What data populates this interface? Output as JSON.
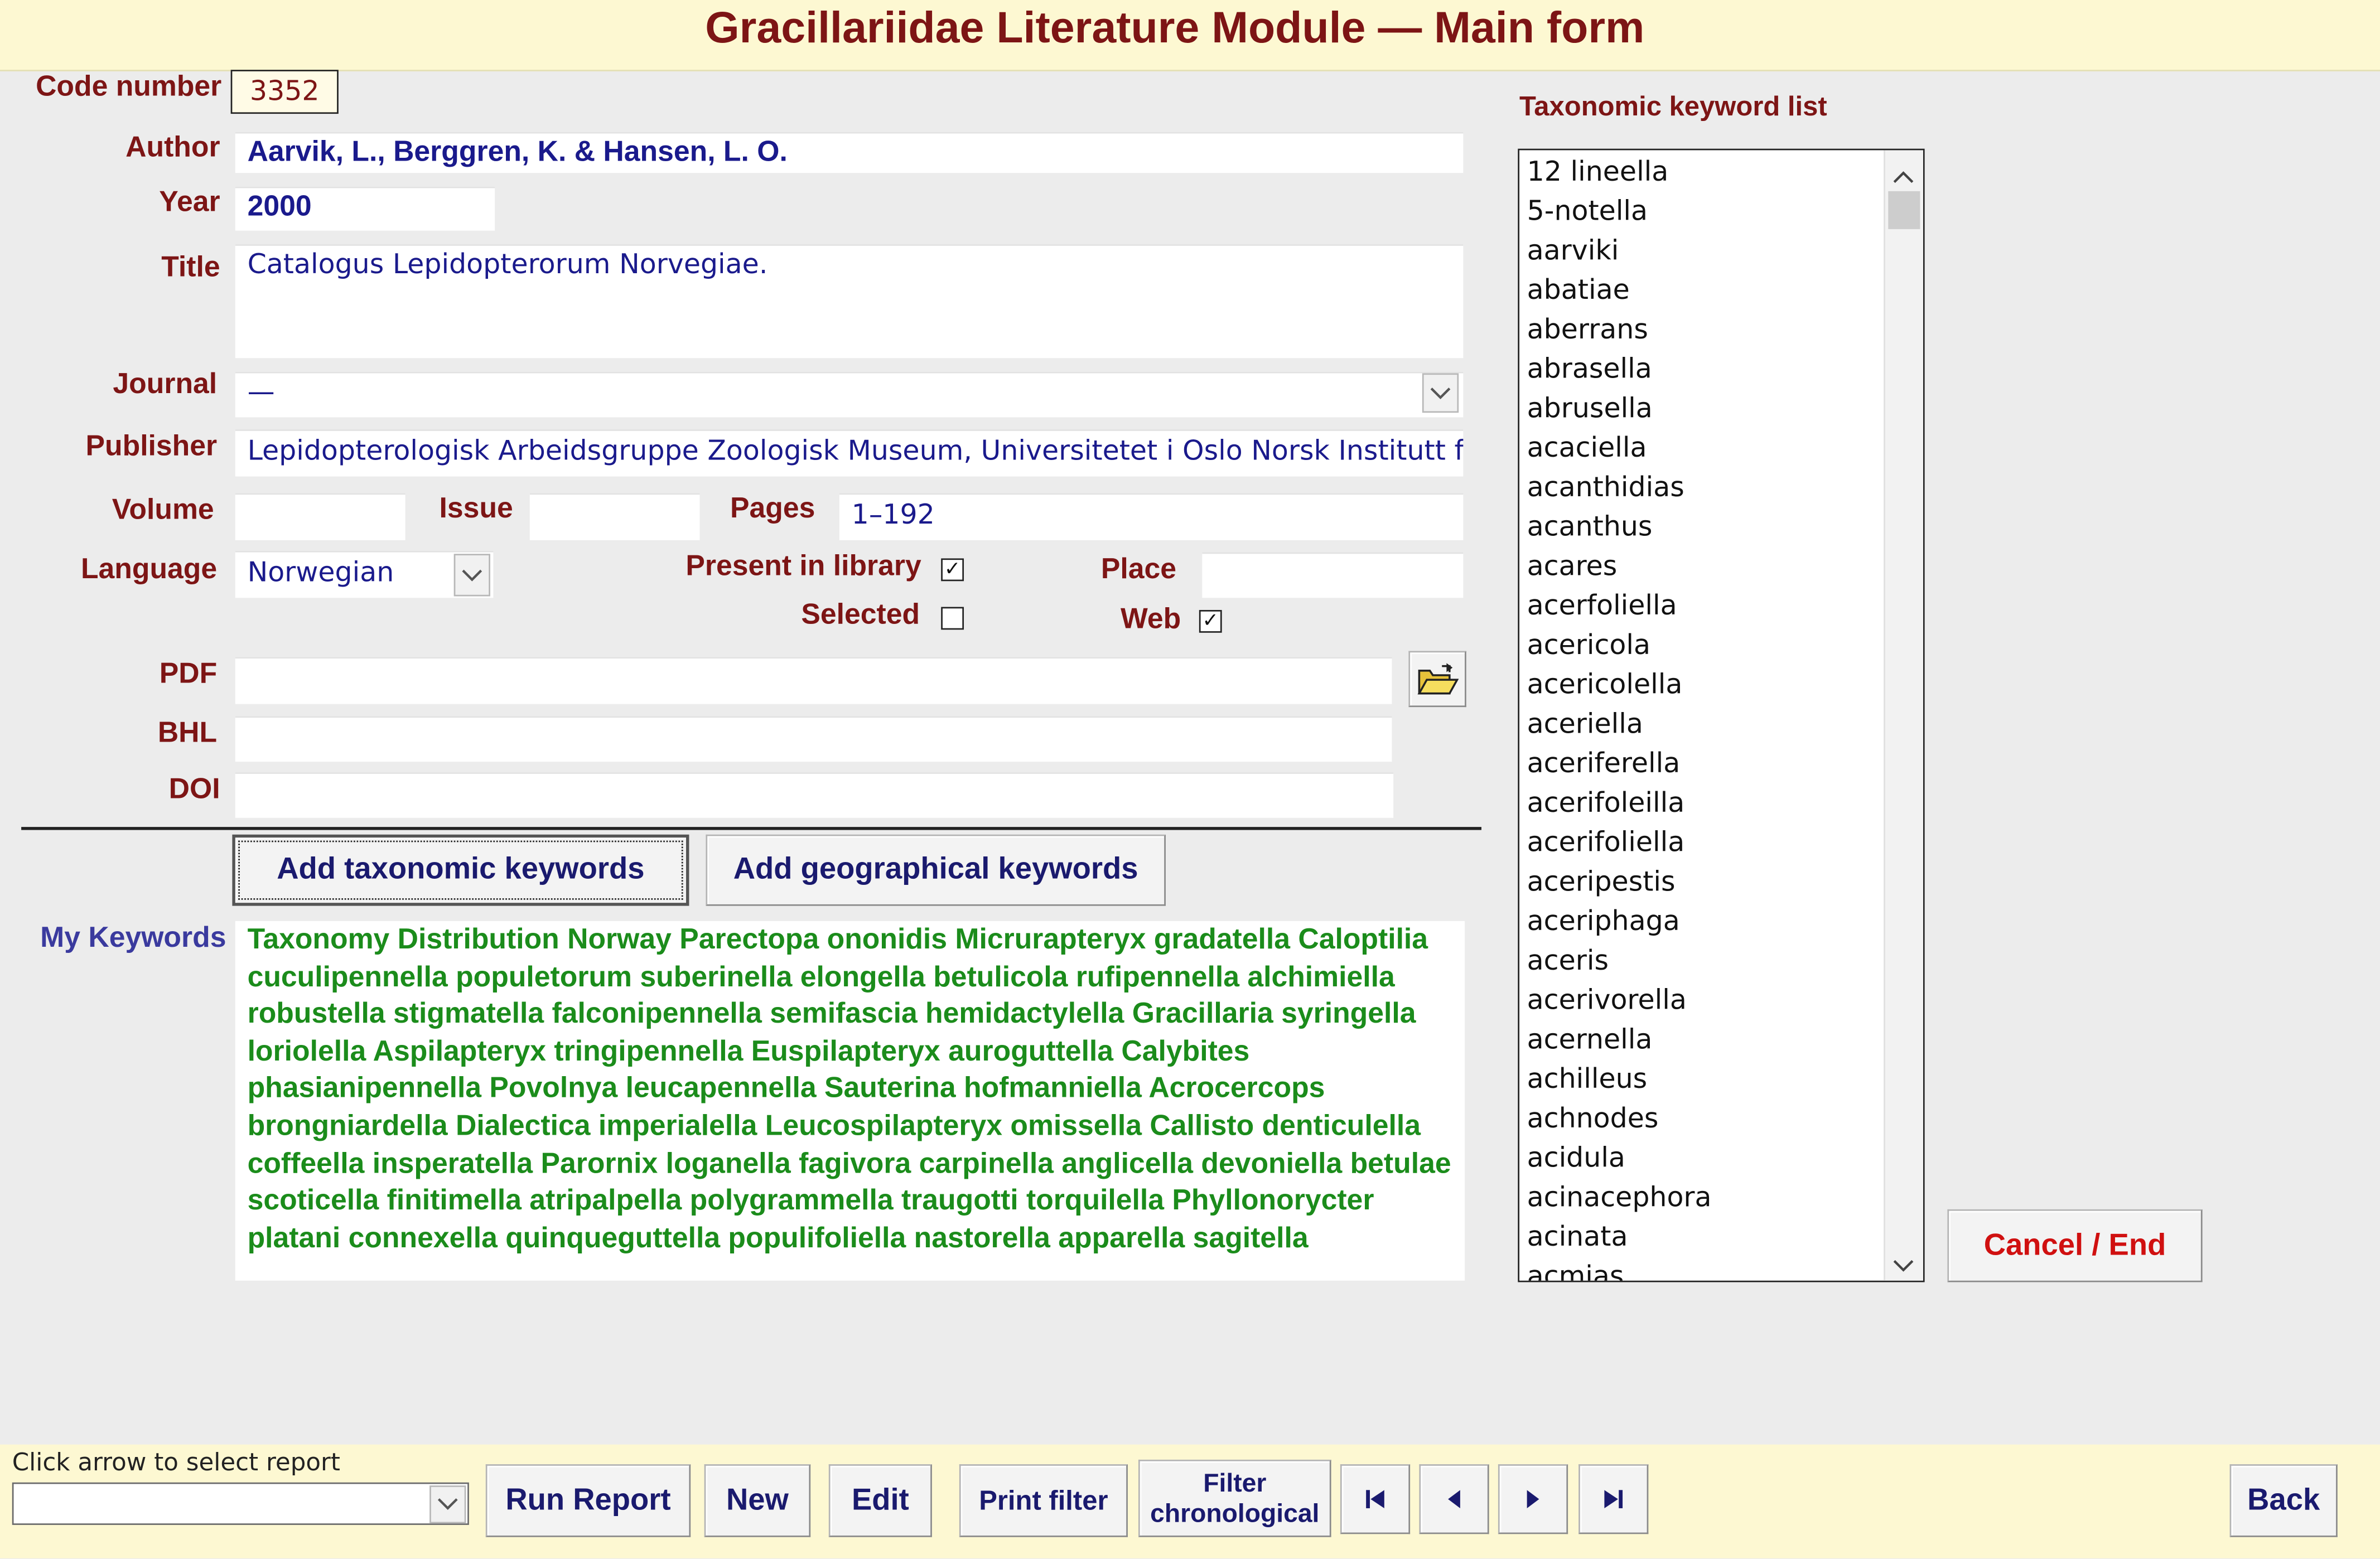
{
  "window": {
    "title": "Gracillariidae Literature Module — Main form"
  },
  "form": {
    "code_label": "Code number",
    "code_value": "3352",
    "author_label": "Author",
    "author_value": "Aarvik, L., Berggren, K. & Hansen, L. O.",
    "year_label": "Year",
    "year_value": "2000",
    "title_label": "Title",
    "title_value": "Catalogus Lepidopterorum Norvegiae.",
    "journal_label": "Journal",
    "journal_value": "—",
    "publisher_label": "Publisher",
    "publisher_value": "Lepidopterologisk Arbeidsgruppe Zoologisk Museum, Universitetet i Oslo Norsk Institutt for Skogforskning",
    "volume_label": "Volume",
    "volume_value": "",
    "issue_label": "Issue",
    "issue_value": "",
    "pages_label": "Pages",
    "pages_value": "1–192",
    "language_label": "Language",
    "language_value": "Norwegian",
    "present_label": "Present in library",
    "present_checked": true,
    "place_label": "Place",
    "place_value": "",
    "selected_label": "Selected",
    "selected_checked": false,
    "web_label": "Web",
    "web_checked": true,
    "pdf_label": "PDF",
    "pdf_value": "",
    "bhl_label": "BHL",
    "bhl_value": "",
    "doi_label": "DOI",
    "doi_value": "",
    "check_mark": "✓"
  },
  "buttons": {
    "add_taxonomic": "Add taxonomic keywords",
    "add_geographical": "Add geographical keywords",
    "cancel_end": "Cancel / End"
  },
  "keywords": {
    "label": "My Keywords",
    "text": "Taxonomy Distribution Norway Parectopa ononidis Micrurapteryx gradatella Caloptilia cuculipennella populetorum suberinella elongella betulicola rufipennella alchimiella robustella stigmatella falconipennella semifascia hemidactylella Gracillaria syringella loriolella Aspilapteryx tringipennella Euspilapteryx auroguttella Calybites phasianipennella Povolnya leucapennella Sauterina hofmanniella Acrocercops brongniardella Dialectica imperialella Leucospilapteryx omissella Callisto denticulella coffeella insperatella Parornix loganella fagivora carpinella anglicella devoniella betulae scoticella finitimella atripalpella polygrammella traugotti torquilella Phyllonorycter platani connexella quinqueguttella populifoliella nastorella apparella sagitella"
  },
  "taxonomic_list": {
    "label": "Taxonomic keyword list",
    "items": [
      "12 lineella",
      "5-notella",
      "aarviki",
      "abatiae",
      "aberrans",
      "abrasella",
      "abrusella",
      "acaciella",
      "acanthidias",
      "acanthus",
      "acares",
      "acerfoliella",
      "acericola",
      "acericolella",
      "aceriella",
      "aceriferella",
      "acerifoleilla",
      "acerifoliella",
      "aceripestis",
      "aceriphaga",
      "aceris",
      "acerivorella",
      "acernella",
      "achilleus",
      "achnodes",
      "acidula",
      "acinacephora",
      "acinata",
      "acmias"
    ]
  },
  "footer": {
    "report_hint": "Click arrow to select report",
    "report_value": "",
    "run_report": "Run Report",
    "new": "New",
    "edit": "Edit",
    "print_filter": "Print filter",
    "filter_line1": "Filter",
    "filter_line2": "chronological",
    "back": "Back"
  },
  "icons": {
    "combo_arrow": "chevron-down-icon",
    "scroll_up": "scroll-up-icon",
    "scroll_down": "scroll-down-icon",
    "folder": "open-folder-icon",
    "first": "first-record-icon",
    "prev": "previous-record-icon",
    "next": "next-record-icon",
    "last": "last-record-icon"
  },
  "colors": {
    "label": "#7d1515",
    "value_text": "#1a1a8c",
    "keywords_text": "#1b8c1b",
    "header_bg": "#fdf8d2",
    "cancel_text": "#d01010"
  }
}
